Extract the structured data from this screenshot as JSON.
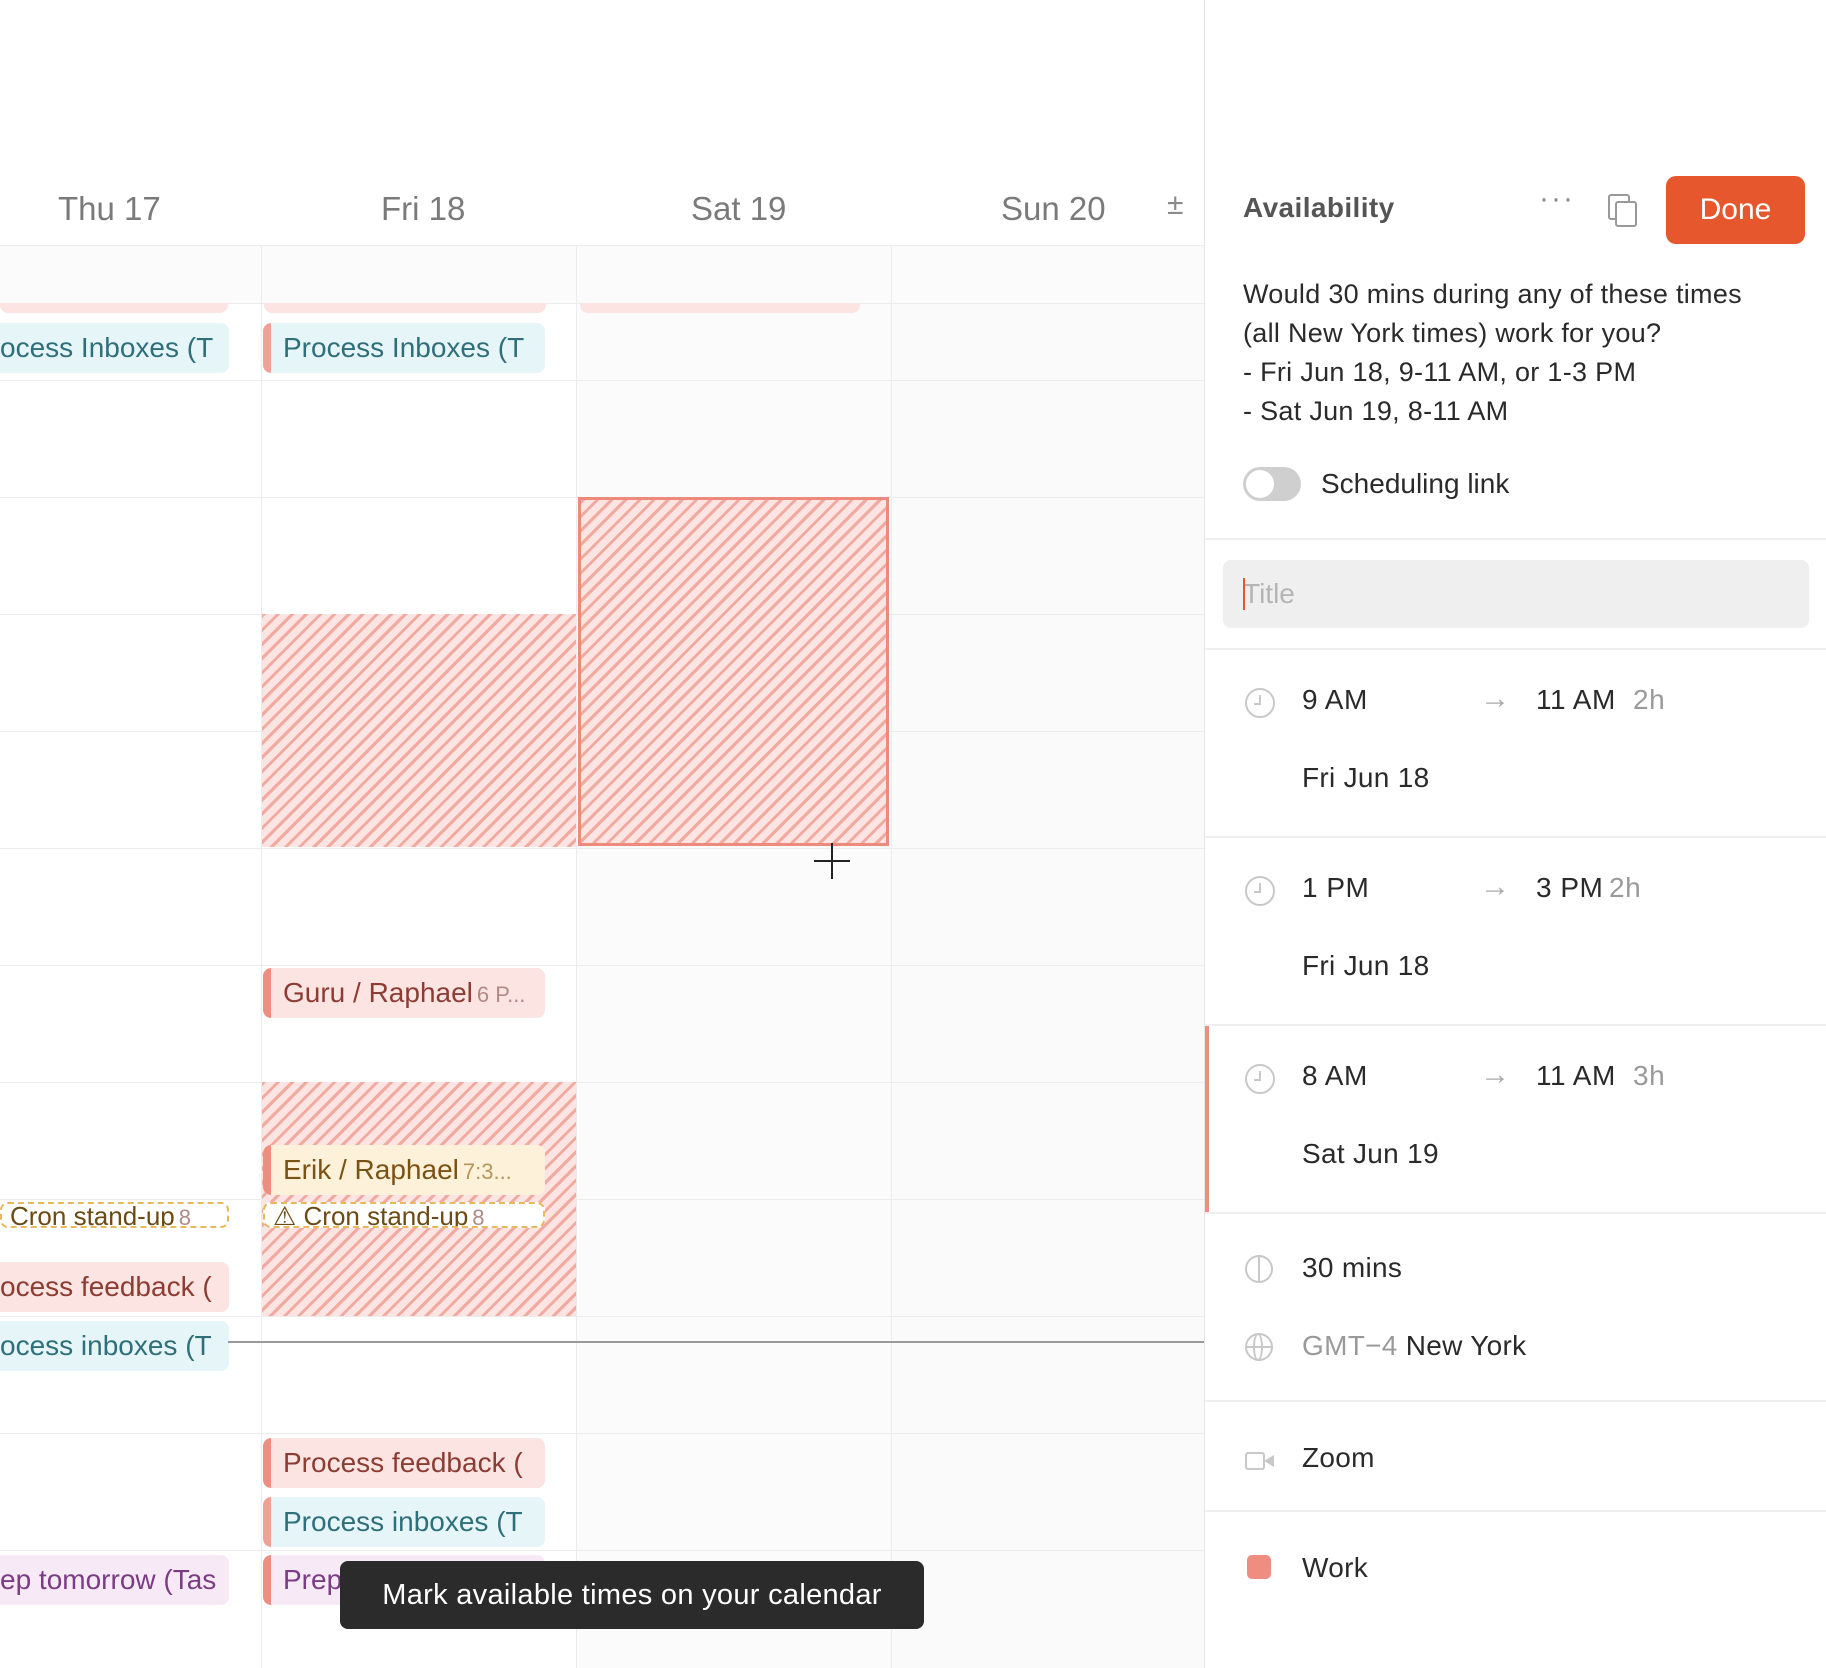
{
  "calendar": {
    "days": [
      "Thu 17",
      "Fri 18",
      "Sat 19",
      "Sun 20"
    ],
    "plus_minus_label": "±",
    "events": {
      "thu_process_inboxes": "ocess Inboxes (T",
      "fri_process_inboxes": "Process Inboxes (T",
      "fri_guru": "Guru / Raphael",
      "fri_guru_time": "6 P...",
      "fri_erik": "Erik / Raphael",
      "fri_erik_time": "7:3...",
      "thu_cron": "Cron stand-up",
      "thu_cron_time": "8",
      "fri_cron": "⚠ Cron stand-up",
      "fri_cron_time": "8",
      "thu_process_feedback": "ocess feedback (",
      "thu_process_inboxes_2": "ocess inboxes (T",
      "fri_process_feedback": "Process feedback (",
      "fri_process_inboxes_2": "Process inboxes (T",
      "thu_prep_tomorrow": "ep tomorrow (Tas",
      "fri_prep": "Prep"
    },
    "tooltip": "Mark available times on your calendar"
  },
  "panel": {
    "title": "Availability",
    "more_label": "···",
    "done_label": "Done",
    "message_lines": [
      "Would 30 mins during any of these times",
      "(all New York times) work for you?",
      "- Fri Jun 18, 9-11 AM, or 1-3 PM",
      "- Sat Jun 19, 8-11 AM"
    ],
    "scheduling_link_label": "Scheduling link",
    "scheduling_link_enabled": false,
    "title_placeholder": "Title",
    "title_value": "",
    "slots": [
      {
        "start": "9 AM",
        "end": "11 AM",
        "duration": "2h",
        "date": "Fri Jun 18",
        "active": false
      },
      {
        "start": "1 PM",
        "end": "3 PM",
        "duration": "2h",
        "date": "Fri Jun 18",
        "active": false
      },
      {
        "start": "8 AM",
        "end": "11 AM",
        "duration": "3h",
        "date": "Sat Jun 19",
        "active": true
      }
    ],
    "arrow": "→",
    "duration_label": "30 mins",
    "timezone_offset": "GMT−4",
    "timezone_name": "New York",
    "conferencing": "Zoom",
    "calendar_name": "Work",
    "calendar_color": "#ef8e80",
    "accent_color": "#e7572d"
  }
}
